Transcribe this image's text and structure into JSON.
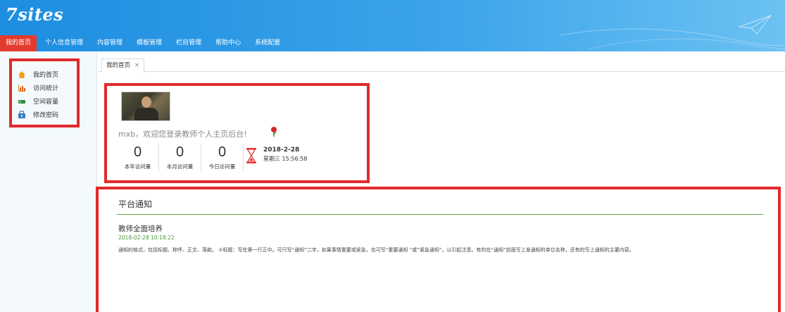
{
  "app": {
    "logo": "7sites"
  },
  "nav": {
    "items": [
      {
        "label": "我的首页",
        "active": true
      },
      {
        "label": "个人信息管理"
      },
      {
        "label": "内容管理"
      },
      {
        "label": "模板管理"
      },
      {
        "label": "栏目管理"
      },
      {
        "label": "帮助中心"
      },
      {
        "label": "系统配置"
      }
    ]
  },
  "sidebar": {
    "items": [
      {
        "label": "我的首页",
        "icon": "home-icon"
      },
      {
        "label": "访问统计",
        "icon": "bar-chart-icon"
      },
      {
        "label": "空间容量",
        "icon": "storage-icon"
      },
      {
        "label": "修改密码",
        "icon": "lock-icon"
      }
    ]
  },
  "tabs": [
    {
      "label": "我的首页",
      "close": "×"
    }
  ],
  "profile": {
    "welcome": "mxb，欢迎您登录教师个人主页后台!",
    "stats": [
      {
        "value": "0",
        "label": "本年访问量"
      },
      {
        "value": "0",
        "label": "本月访问量"
      },
      {
        "value": "0",
        "label": "今日访问量"
      }
    ],
    "date": "2018-2-28",
    "time": "星期三 15:56:58"
  },
  "notice": {
    "title": "平台通知",
    "article": {
      "title": "教师全面培养",
      "date": "2018-02-28 10:18:22",
      "body": "通知的格式，包括标题、称呼、正文、落款。 ①标题：写在第一行正中。可只写“通知”二字，如果事情重要或紧急，也可写“重要通知 ”或“紧急通知”，以引起注意。有的在“通知”前面写上发通知的单位名称，还有的写上通知的主要内容。"
    }
  },
  "colors": {
    "header": "#1d8de0",
    "highlight": "#e12a2a",
    "accent_green": "#5aa640"
  }
}
